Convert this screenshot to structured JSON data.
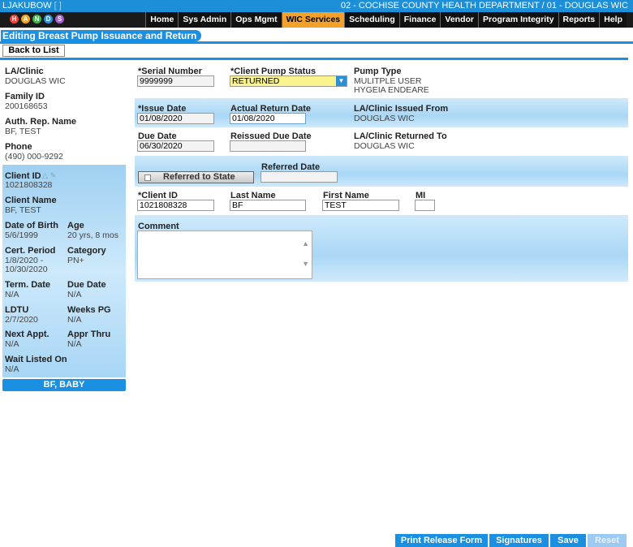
{
  "topbar": {
    "user": "LJAKUBOW",
    "session": "[ ]",
    "org": "02 - COCHISE COUNTY HEALTH DEPARTMENT / 01 - DOUGLAS WIC"
  },
  "logo": {
    "letters": [
      "H",
      "A",
      "N",
      "D",
      "S"
    ],
    "colors": [
      "#e8413a",
      "#f2a51d",
      "#3fb34f",
      "#2b8fd6",
      "#a45cc7"
    ]
  },
  "nav": [
    "Home",
    "Sys Admin",
    "Ops Mgmt",
    "WIC Services",
    "Scheduling",
    "Finance",
    "Vendor",
    "Program Integrity",
    "Reports",
    "Help"
  ],
  "nav_active": "WIC Services",
  "page_title": "Editing Breast Pump Issuance and Return",
  "back_label": "Back to List",
  "sidebar": {
    "la_clinic_label": "LA/Clinic",
    "la_clinic": "DOUGLAS WIC",
    "family_id_label": "Family ID",
    "family_id": "200168653",
    "auth_rep_label": "Auth. Rep. Name",
    "auth_rep": "BF, TEST",
    "phone_label": "Phone",
    "phone": "(490) 000-9292",
    "client_id_label": "Client ID",
    "client_id": "1021808328",
    "client_name_label": "Client Name",
    "client_name": "BF, TEST",
    "dob_label": "Date of Birth",
    "dob": "5/6/1999",
    "age_label": "Age",
    "age": "20 yrs, 8 mos",
    "cert_label": "Cert. Period",
    "cert_line1": "1/8/2020 -",
    "cert_line2": "10/30/2020",
    "category_label": "Category",
    "category": "PN+",
    "term_label": "Term. Date",
    "term": "N/A",
    "due_label": "Due Date",
    "due": "N/A",
    "ldtu_label": "LDTU",
    "ldtu": "2/7/2020",
    "weeks_label": "Weeks PG",
    "weeks": "N/A",
    "next_label": "Next Appt.",
    "next": "N/A",
    "appr_label": "Appr Thru",
    "appr": "N/A",
    "wait_label": "Wait Listed On",
    "wait": "N/A",
    "baby_label": "BF, BABY"
  },
  "form": {
    "serial_label": "*Serial Number",
    "serial": "9999999",
    "status_label": "*Client Pump Status",
    "status": "RETURNED",
    "pump_type_label": "Pump Type",
    "pump_type_line1": "MULITPLE USER",
    "pump_type_line2": "HYGEIA ENDEARE",
    "issue_date_label": "*Issue Date",
    "issue_date": "01/08/2020",
    "return_date_label": "Actual Return Date",
    "return_date": "01/08/2020",
    "issued_from_label": "LA/Clinic Issued From",
    "issued_from": "DOUGLAS WIC",
    "due_date_label": "Due Date",
    "due_date": "06/30/2020",
    "reissued_label": "Reissued Due Date",
    "reissued": "",
    "returned_to_label": "LA/Clinic Returned To",
    "returned_to": "DOUGLAS WIC",
    "referred_btn": "Referred to State",
    "referred_date_label": "Referred Date",
    "referred_date": "",
    "client_id_label": "*Client ID",
    "client_id": "1021808328",
    "last_name_label": "Last Name",
    "last_name": "BF",
    "first_name_label": "First Name",
    "first_name": "TEST",
    "mi_label": "MI",
    "mi": "",
    "comment_label": "Comment",
    "comment": ""
  },
  "footer": {
    "print": "Print Release Form",
    "signatures": "Signatures",
    "save": "Save",
    "reset": "Reset"
  }
}
